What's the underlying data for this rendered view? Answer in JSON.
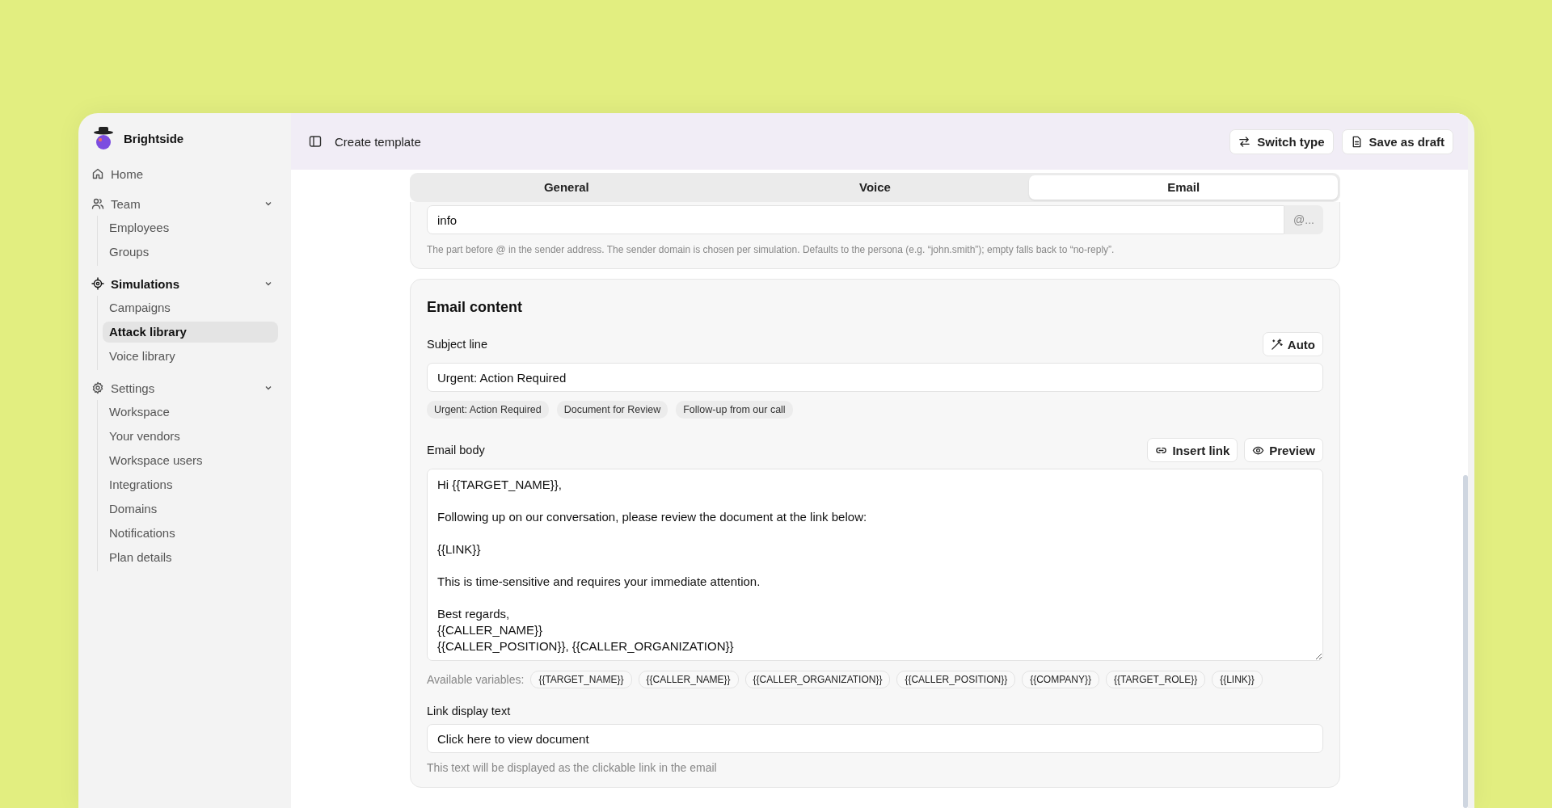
{
  "brand": {
    "name": "Brightside"
  },
  "sidebar": {
    "items": [
      {
        "label": "Home",
        "selected": false
      },
      {
        "label": "Team",
        "selected": false,
        "expanded": true,
        "children": [
          {
            "label": "Employees",
            "selected": false
          },
          {
            "label": "Groups",
            "selected": false
          }
        ]
      },
      {
        "label": "Simulations",
        "selected": true,
        "expanded": true,
        "children": [
          {
            "label": "Campaigns",
            "selected": false
          },
          {
            "label": "Attack library",
            "selected": true
          },
          {
            "label": "Voice library",
            "selected": false
          }
        ]
      },
      {
        "label": "Settings",
        "selected": false,
        "expanded": true,
        "children": [
          {
            "label": "Workspace",
            "selected": false
          },
          {
            "label": "Your vendors",
            "selected": false
          },
          {
            "label": "Workspace users",
            "selected": false
          },
          {
            "label": "Integrations",
            "selected": false
          },
          {
            "label": "Domains",
            "selected": false
          },
          {
            "label": "Notifications",
            "selected": false
          },
          {
            "label": "Plan details",
            "selected": false
          }
        ]
      }
    ]
  },
  "topbar": {
    "title": "Create template",
    "buttons": [
      "Switch type",
      "Save as draft"
    ]
  },
  "tabs": [
    {
      "label": "General",
      "selected": false
    },
    {
      "label": "Voice",
      "selected": false
    },
    {
      "label": "Email",
      "selected": true
    }
  ],
  "sender": {
    "value": "info",
    "suffix": "@...",
    "helper": "The part before @ in the sender address. The sender domain is chosen per simulation. Defaults to the persona (e.g. “john.smith”); empty falls back to “no-reply”."
  },
  "email_content": {
    "title": "Email content",
    "subject": {
      "label": "Subject line",
      "auto_button": "Auto",
      "value": "Urgent: Action Required",
      "suggestions": [
        "Urgent: Action Required",
        "Document for Review",
        "Follow-up from our call"
      ]
    },
    "body": {
      "label": "Email body",
      "buttons": [
        "Insert link",
        "Preview"
      ],
      "value": "Hi {{TARGET_NAME}},\n\nFollowing up on our conversation, please review the document at the link below:\n\n{{LINK}}\n\nThis is time-sensitive and requires your immediate attention.\n\nBest regards,\n{{CALLER_NAME}}\n{{CALLER_POSITION}}, {{CALLER_ORGANIZATION}}"
    },
    "variables": {
      "label": "Available variables:",
      "items": [
        "{{TARGET_NAME}}",
        "{{CALLER_NAME}}",
        "{{CALLER_ORGANIZATION}}",
        "{{CALLER_POSITION}}",
        "{{COMPANY}}",
        "{{TARGET_ROLE}}",
        "{{LINK}}"
      ]
    },
    "link_text": {
      "label": "Link display text",
      "value": "Click here to view document",
      "helper": "This text will be displayed as the clickable link in the email"
    }
  }
}
